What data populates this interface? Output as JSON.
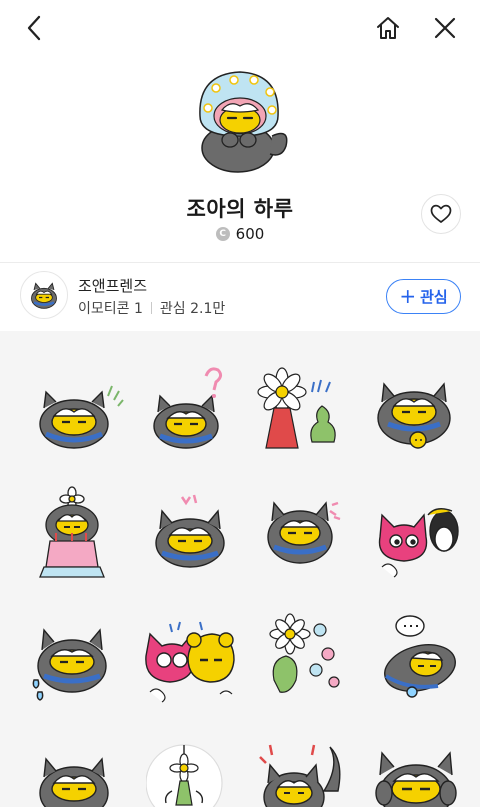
{
  "nav": {
    "back_icon": "chevron-left-icon",
    "home_icon": "home-icon",
    "close_icon": "close-icon"
  },
  "product": {
    "title": "조아의 하루",
    "price_coin_symbol": "C",
    "price": "600",
    "favorite_icon": "heart-outline-icon"
  },
  "creator": {
    "name": "조앤프렌즈",
    "emoticon_label": "이모티콘 1",
    "followers_label": "관심 2.1만",
    "follow_button": {
      "plus": "+",
      "label": "관심"
    }
  },
  "stickers": [
    {
      "name": "cat-fidget"
    },
    {
      "name": "cat-question"
    },
    {
      "name": "daisy-and-sprout"
    },
    {
      "name": "cat-with-chick"
    },
    {
      "name": "cat-birthday-cake"
    },
    {
      "name": "cat-annoyed"
    },
    {
      "name": "cat-angry"
    },
    {
      "name": "pink-cat-and-penguin"
    },
    {
      "name": "cat-sad-tears"
    },
    {
      "name": "pink-and-yellow-friends"
    },
    {
      "name": "daisy-flowers"
    },
    {
      "name": "cat-lying-down"
    },
    {
      "name": "cat-blush"
    },
    {
      "name": "daisy-hanging"
    },
    {
      "name": "cat-startled"
    },
    {
      "name": "cat-hands-up"
    }
  ],
  "colors": {
    "accent": "#2563eb",
    "cat_body": "#6b6b6b",
    "cat_face": "#f5d100",
    "scarf": "#3a6fc7",
    "background_grid": "#f5f5f5"
  }
}
